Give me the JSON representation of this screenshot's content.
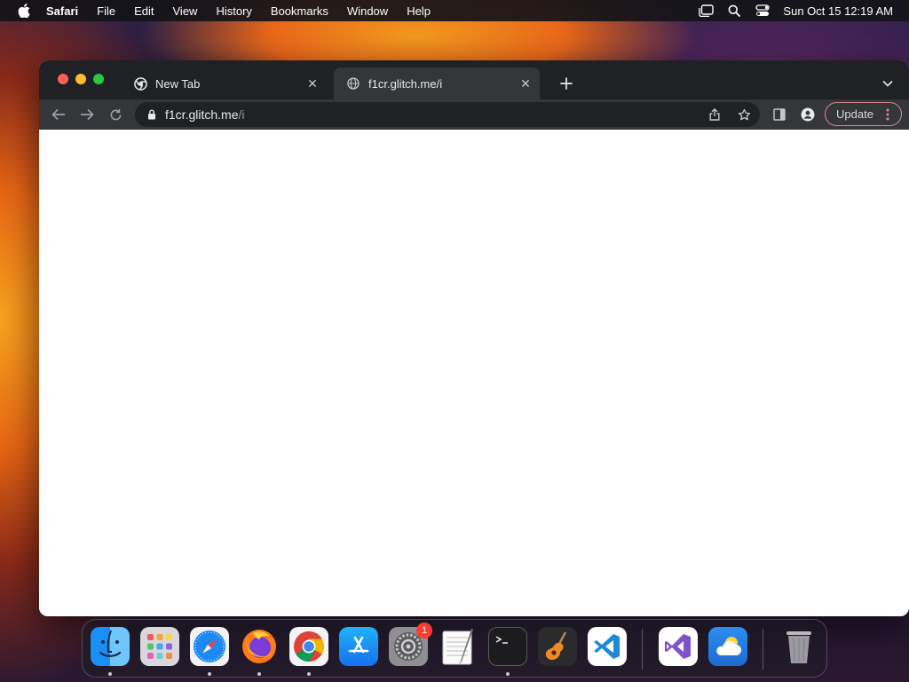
{
  "menubar": {
    "app_name": "Safari",
    "items": [
      "File",
      "Edit",
      "View",
      "History",
      "Bookmarks",
      "Window",
      "Help"
    ],
    "clock": "Sun Oct 15  12:19 AM"
  },
  "browser": {
    "tabs": [
      {
        "title": "New Tab",
        "icon": "chrome-icon",
        "active": false
      },
      {
        "title": "f1cr.glitch.me/i",
        "icon": "globe-icon",
        "active": true
      }
    ],
    "address": {
      "host": "f1cr.glitch.me",
      "path": "/i"
    },
    "update_label": "Update",
    "colors": {
      "titlebar": "#202124",
      "toolbar": "#35363a",
      "update_border": "#d88f86"
    }
  },
  "dock": {
    "apps": [
      {
        "name": "Finder",
        "icon": "finder-icon",
        "running": true
      },
      {
        "name": "Launchpad",
        "icon": "launchpad-icon",
        "running": false
      },
      {
        "name": "Safari",
        "icon": "safari-icon",
        "running": true
      },
      {
        "name": "Firefox",
        "icon": "firefox-icon",
        "running": true
      },
      {
        "name": "Google Chrome",
        "icon": "chrome-icon",
        "running": true
      },
      {
        "name": "App Store",
        "icon": "app-store-icon",
        "running": false
      },
      {
        "name": "System Settings",
        "icon": "system-settings-icon",
        "running": false,
        "badge": "1"
      },
      {
        "name": "TextEdit",
        "icon": "textedit-icon",
        "running": false
      },
      {
        "name": "Terminal",
        "icon": "terminal-icon",
        "running": true
      },
      {
        "name": "GarageBand",
        "icon": "garageband-icon",
        "running": false
      },
      {
        "name": "Visual Studio Code",
        "icon": "vscode-icon",
        "running": false
      },
      {
        "name": "Visual Studio",
        "icon": "visual-studio-icon",
        "running": false
      },
      {
        "name": "Weather",
        "icon": "weather-icon",
        "running": false
      },
      {
        "name": "Trash",
        "icon": "trash-icon",
        "running": false
      }
    ]
  }
}
